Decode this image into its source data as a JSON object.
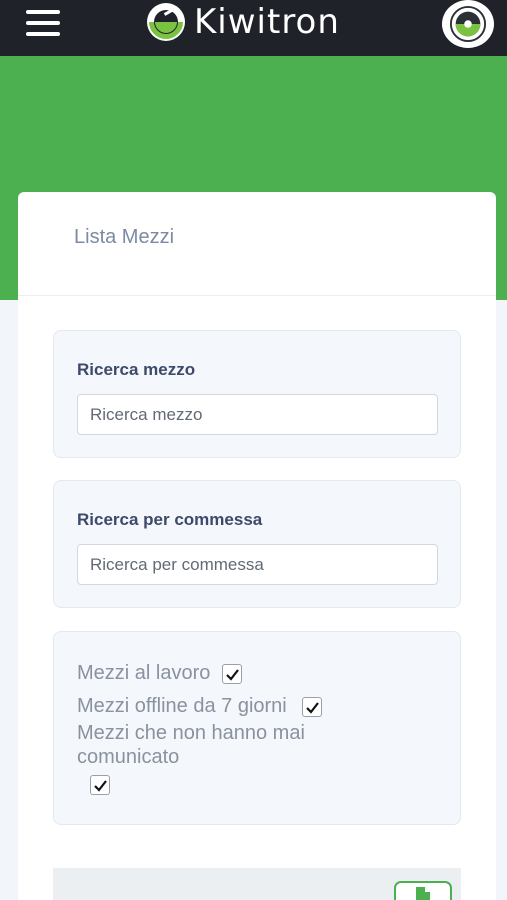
{
  "header": {
    "brand_name": "Kiwitron",
    "menu_icon": "hamburger-menu-icon",
    "logo_icon": "kiwi-logo-icon",
    "avatar_icon": "user-avatar-icon"
  },
  "colors": {
    "header_bg": "#1f2228",
    "brand_green": "#4caf50",
    "page_bg": "#f2f5fa",
    "panel_bg": "#f4f7fb"
  },
  "card": {
    "title": "Lista Mezzi"
  },
  "search_vehicle": {
    "label": "Ricerca mezzo",
    "placeholder": "Ricerca mezzo",
    "value": ""
  },
  "search_order": {
    "label": "Ricerca per commessa",
    "placeholder": "Ricerca per commessa",
    "value": ""
  },
  "filters": [
    {
      "label": "Mezzi al lavoro",
      "checked": true
    },
    {
      "label": "Mezzi offline da 7 giorni",
      "checked": true
    },
    {
      "label_line1": "Mezzi che non hanno mai",
      "label_line2": "comunicato",
      "checked": true
    }
  ],
  "export_button": {
    "icon": "document-icon"
  }
}
